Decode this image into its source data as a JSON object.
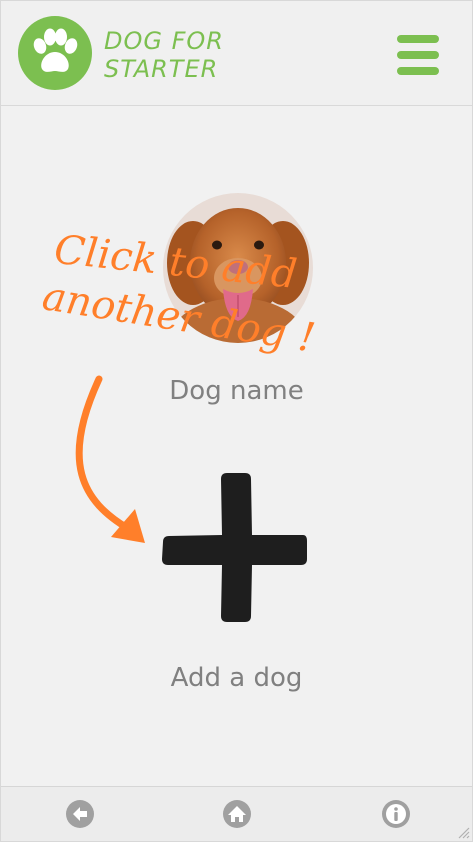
{
  "header": {
    "brand_line1": "DOG FOR",
    "brand_line2": "STARTER",
    "logo_icon": "paw-icon",
    "menu_icon": "hamburger-menu-icon"
  },
  "dogs": [
    {
      "name": "Dog name",
      "photo": "dog-photo"
    }
  ],
  "hint": {
    "line1": "Click to add",
    "line2": "another dog !"
  },
  "add": {
    "label": "Add a dog",
    "icon": "plus-icon"
  },
  "footer": {
    "back_icon": "back-arrow-icon",
    "home_icon": "home-icon",
    "info_icon": "info-icon"
  },
  "colors": {
    "brand_green": "#7cbf50",
    "hint_orange": "#ff7f2a",
    "label_gray": "#808080",
    "plus_black": "#1e1e1e",
    "footer_icon_gray": "#a0a0a0"
  }
}
